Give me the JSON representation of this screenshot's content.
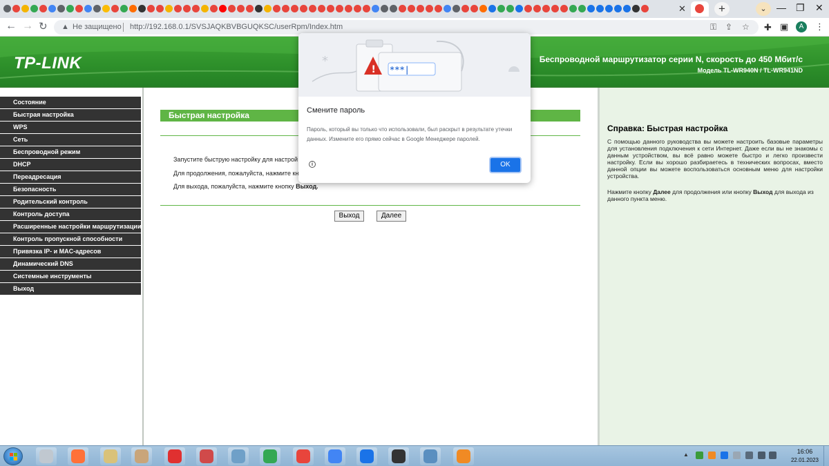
{
  "browser": {
    "new_tab_symbol": "+",
    "close_tab_symbol": "✕",
    "tab_search_symbol": "⌄",
    "window_controls": [
      "—",
      "❐",
      "✕"
    ],
    "tab_icon_colors": [
      "#5f6368",
      "#e8453c",
      "#f4b400",
      "#34a853",
      "#e8453c",
      "#4285f4",
      "#5f6368",
      "#34a853",
      "#e8453c",
      "#4285f4",
      "#5f6368",
      "#fbbc05",
      "#e8453c",
      "#34a853",
      "#ff6d00",
      "#333333",
      "#e8453c",
      "#e8453c",
      "#f4b400",
      "#e8453c",
      "#e8453c",
      "#e8453c",
      "#f4b400",
      "#e8453c",
      "#ff0000",
      "#e8453c",
      "#e8453c",
      "#e8453c",
      "#333333",
      "#f4b400",
      "#e8453c",
      "#e8453c",
      "#e8453c",
      "#e8453c",
      "#e8453c",
      "#e8453c",
      "#e8453c",
      "#e8453c",
      "#e8453c",
      "#e8453c",
      "#e8453c",
      "#4285f4",
      "#5f6368",
      "#5f6368",
      "#e8453c",
      "#e8453c",
      "#e8453c",
      "#e8453c",
      "#e8453c",
      "#4285f4",
      "#5f6368",
      "#e8453c",
      "#e8453c",
      "#ff6d00",
      "#1a73e8",
      "#34a853",
      "#34a853",
      "#1a73e8",
      "#e8453c",
      "#e8453c",
      "#e8453c",
      "#e8453c",
      "#e8453c",
      "#34a853",
      "#34a853",
      "#1a73e8",
      "#1a73e8",
      "#1a73e8",
      "#1a73e8",
      "#1a73e8",
      "#333333",
      "#e8453c"
    ],
    "not_secure": "Не защищено",
    "url": "http://192.168.0.1/SVSJAQKBVBGUQKSC/userRpm/Index.htm",
    "profile_initial": "A"
  },
  "router": {
    "logo": "TP-LINK",
    "title": "Беспроводной маршрутизатор серии N, скорость до 450 Мбит/с",
    "model": "Модель TL-WR940N / TL-WR941ND",
    "menu": [
      "Состояние",
      "Быстрая настройка",
      "WPS",
      "Сеть",
      "Беспроводной режим",
      "DHCP",
      "Переадресация",
      "Безопасность",
      "Родительский контроль",
      "Контроль доступа",
      "Расширенные настройки маршрутизации",
      "Контроль пропускной способности",
      "Привязка IP- и MAC-адресов",
      "Динамический DNS",
      "Системные инструменты",
      "Выход"
    ],
    "section_title": "Быстрая настройка",
    "line1": "Запустите быструю настройку для настрой",
    "line2": "Для продолжения, пожалуйста, нажмите кно",
    "line3_prefix": "Для выхода, пожалуйста, нажмите кнопку",
    "line3_bold": "Выход.",
    "exit_button": "Выход",
    "next_button": "Далее"
  },
  "help": {
    "title": "Справка: Быстрая настройка",
    "paragraph1": "С помощью данного руководства вы можете настроить базовые параметры для установления подключения к сети Интернет. Даже если вы не знакомы с данным устройством, вы всё равно можете быстро и легко произвести настройку. Если вы хорошо разбираетесь в технических вопросах, вместо данной опции вы можете воспользоваться основным меню для настройки устройства.",
    "p2_a": "Нажмите кнопку ",
    "p2_b": "Далее",
    "p2_c": " для продолжения или кнопку ",
    "p2_d": "Выход",
    "p2_e": " для выхода из данного пункта меню."
  },
  "popup": {
    "title": "Смените пароль",
    "text": "Пароль, который вы только что использовали, был раскрыт в результате утечки данных. Измените его прямо сейчас в Google Менеджере паролей.",
    "illustration_text": "***|",
    "info_symbol": "i",
    "ok": "OK"
  },
  "taskbar": {
    "time": "16:06",
    "date": "22.01.2023",
    "app_icon_colors": [
      "#c0c8d0",
      "#ff7139",
      "#d9c27a",
      "#c9a57a",
      "#e03030",
      "#d04a4a",
      "#6fa0c8",
      "#34a853",
      "#e8453c",
      "#4285f4",
      "#1a73e8",
      "#333333",
      "#5a8fc0",
      "#f08a24"
    ]
  }
}
